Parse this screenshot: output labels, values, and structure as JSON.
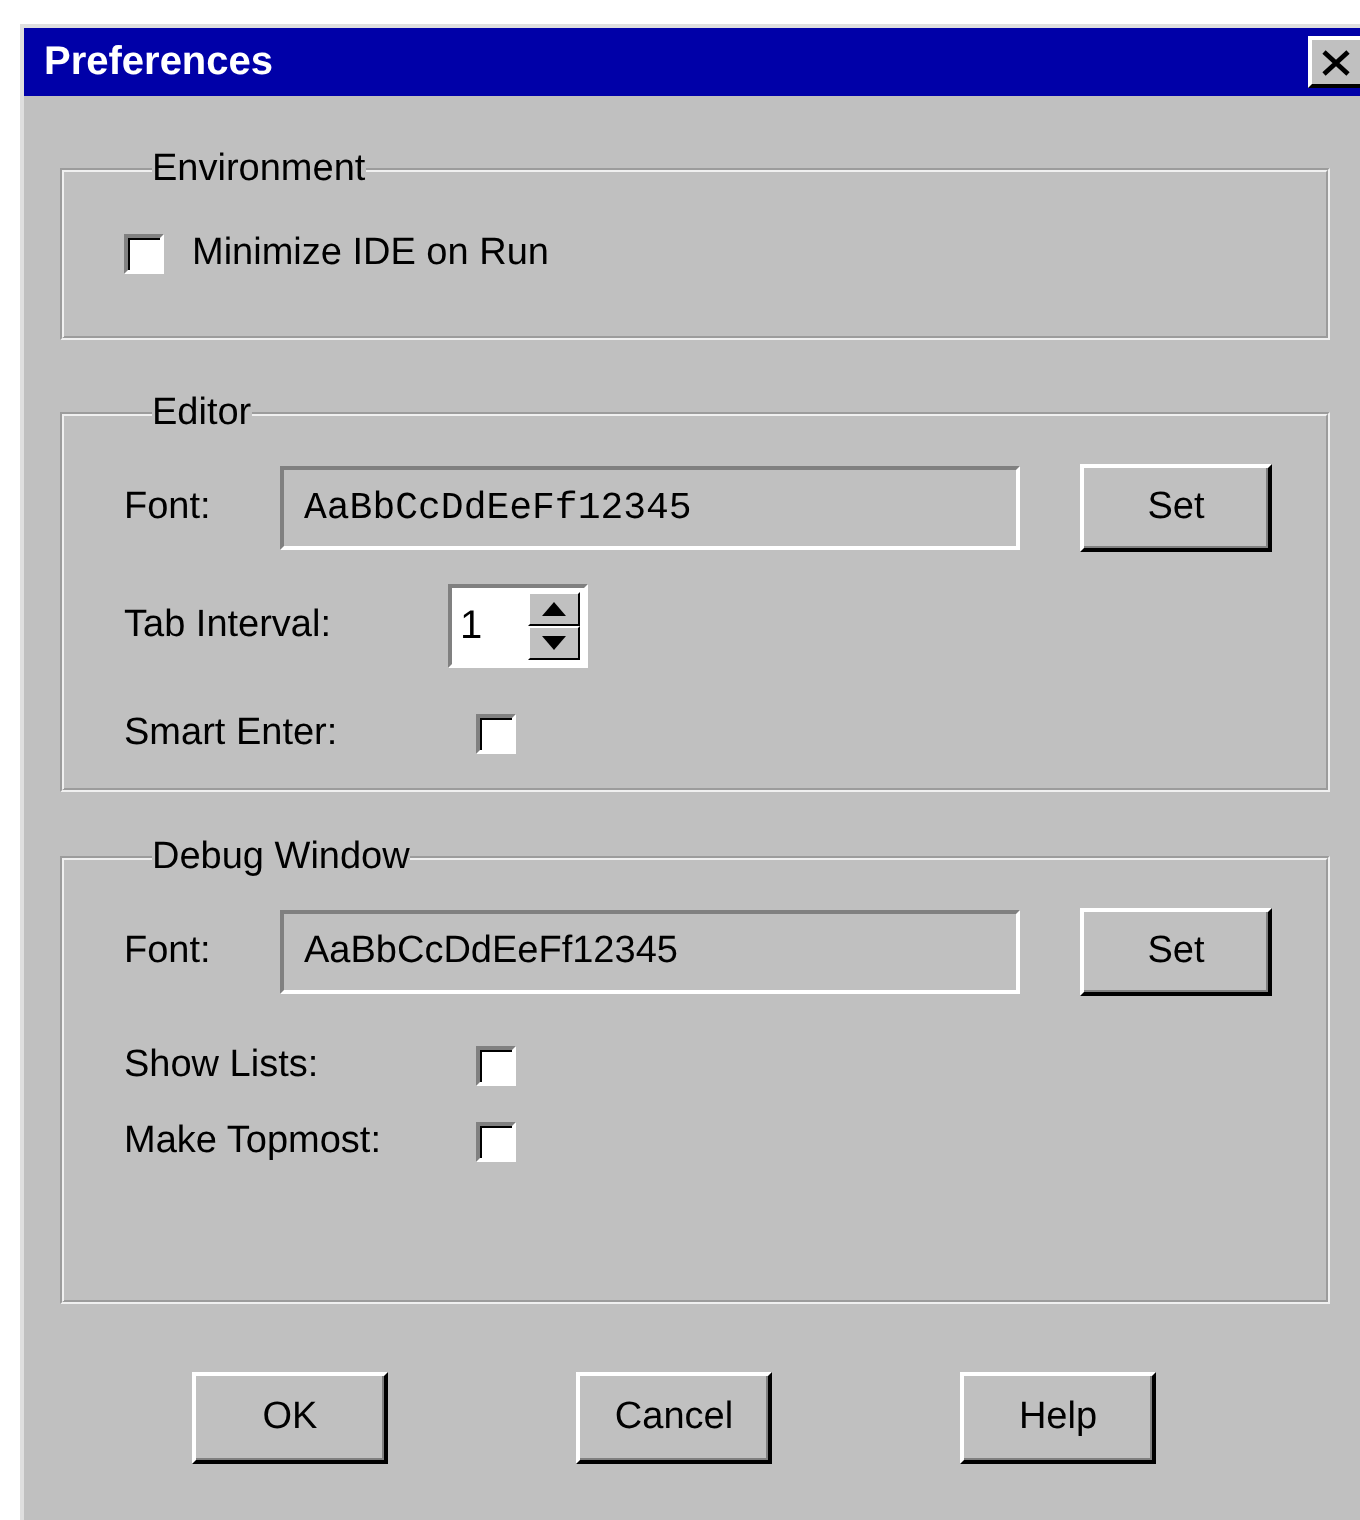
{
  "window": {
    "title": "Preferences"
  },
  "groups": [
    {
      "title": "Environment",
      "rows": [
        {
          "kind": "checkbox",
          "label": "Minimize IDE on Run",
          "checked": false
        }
      ]
    },
    {
      "title": "Editor",
      "rows": [
        {
          "kind": "fixed-font",
          "label": "Font:",
          "value": "AaBbCcDdEeFf12345",
          "button": "Set"
        },
        {
          "kind": "spinner",
          "label": "Tab Interval:",
          "value": "1"
        },
        {
          "kind": "labeled-check",
          "label": "Smart Enter:",
          "checked": false
        }
      ]
    },
    {
      "title": "Debug Window",
      "rows": [
        {
          "kind": "font",
          "label": "Font:",
          "value": "AaBbCcDdEeFf12345",
          "button": "Set"
        },
        {
          "kind": "labeled-check",
          "label": "Show Lists:",
          "checked": false
        },
        {
          "kind": "labeled-check",
          "label": "Make Topmost:",
          "checked": false
        }
      ]
    }
  ],
  "buttons": [
    "OK",
    "Cancel",
    "Help"
  ]
}
